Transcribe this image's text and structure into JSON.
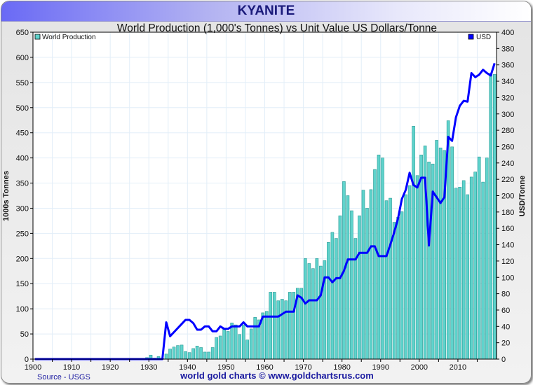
{
  "header": {
    "title": "KYANITE"
  },
  "footer": {
    "source": "Source - USGS",
    "credit": "world gold charts © www.goldchartsrus.com"
  },
  "colors": {
    "bar": "#5fd3cc",
    "bar_edge": "#2a9a95",
    "line": "#0000ff",
    "grid": "#e2eef8",
    "title": "#1a1a7a"
  },
  "chart_data": {
    "type": "bar+line",
    "title": "World Production (1,000's Tonnes) vs Unit Value US Dollars/Tonne",
    "xlabel": "",
    "ylabel": "1000s Tonnes",
    "y2label": "USD/Tonne",
    "xlim": [
      1900,
      2019
    ],
    "ylim": [
      0,
      650
    ],
    "y2lim": [
      0,
      400
    ],
    "xticks": [
      1900,
      1910,
      1920,
      1930,
      1940,
      1950,
      1960,
      1970,
      1980,
      1990,
      2000,
      2010
    ],
    "yticks": [
      0,
      50,
      100,
      150,
      200,
      250,
      300,
      350,
      400,
      450,
      500,
      550,
      600,
      650
    ],
    "y2ticks": [
      0,
      20,
      40,
      60,
      80,
      100,
      120,
      140,
      160,
      180,
      200,
      220,
      240,
      260,
      280,
      300,
      320,
      340,
      360,
      380,
      400
    ],
    "grid": true,
    "legend": [
      {
        "name": "World Production",
        "position": "top-left"
      },
      {
        "name": "USD",
        "position": "top-right"
      }
    ],
    "start_year": 1900,
    "series": [
      {
        "name": "World Production",
        "type": "bar",
        "axis": "left",
        "values": [
          0,
          0,
          0,
          0,
          0,
          0,
          0,
          0,
          0,
          0,
          0,
          0,
          0,
          0,
          0,
          0,
          0,
          0,
          0,
          0,
          0,
          0,
          0,
          0,
          0,
          0,
          0,
          0,
          1,
          3,
          8,
          2,
          5,
          1,
          10,
          20,
          24,
          27,
          28,
          15,
          13,
          21,
          26,
          23,
          14,
          14,
          23,
          43,
          46,
          60,
          55,
          72,
          68,
          49,
          68,
          38,
          60,
          83,
          78,
          92,
          95,
          133,
          133,
          116,
          119,
          116,
          133,
          133,
          141,
          141,
          200,
          190,
          180,
          200,
          185,
          196,
          232,
          252,
          240,
          285,
          353,
          325,
          295,
          240,
          285,
          336,
          300,
          337,
          377,
          406,
          400,
          315,
          320,
          272,
          282,
          293,
          327,
          345,
          463,
          365,
          406,
          424,
          392,
          388,
          435,
          420,
          415,
          474,
          422,
          340,
          342,
          355,
          327,
          362,
          372,
          402,
          352,
          400,
          568,
          566
        ]
      },
      {
        "name": "USD",
        "type": "line",
        "axis": "right",
        "values": [
          0,
          0,
          0,
          0,
          0,
          0,
          0,
          0,
          0,
          0,
          0,
          0,
          0,
          0,
          0,
          0,
          0,
          0,
          0,
          0,
          0,
          0,
          0,
          0,
          0,
          0,
          0,
          0,
          0,
          0,
          0,
          0,
          0,
          0,
          45,
          28,
          33,
          38,
          43,
          48,
          48,
          44,
          36,
          36,
          40,
          40,
          34,
          34,
          40,
          37,
          37,
          40,
          40,
          40,
          45,
          40,
          40,
          40,
          40,
          52,
          52,
          52,
          52,
          52,
          55,
          58,
          58,
          58,
          78,
          75,
          68,
          72,
          72,
          72,
          78,
          100,
          100,
          94,
          99,
          99,
          108,
          122,
          122,
          122,
          130,
          130,
          130,
          138,
          138,
          126,
          126,
          126,
          140,
          155,
          172,
          196,
          207,
          228,
          213,
          210,
          222,
          222,
          139,
          205,
          198,
          191,
          198,
          272,
          267,
          296,
          310,
          316,
          315,
          350,
          345,
          348,
          354,
          350,
          347,
          362
        ]
      }
    ]
  }
}
